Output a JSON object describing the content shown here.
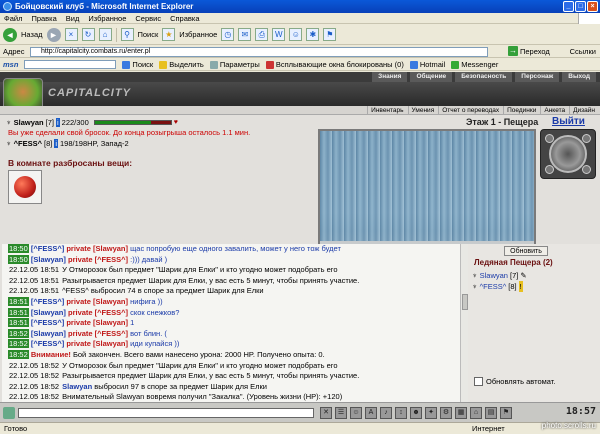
{
  "window": {
    "title": "Бойцовский клуб - Microsoft Internet Explorer",
    "min_label": "_",
    "max_label": "□",
    "close_label": "×"
  },
  "menu": [
    "Файл",
    "Правка",
    "Вид",
    "Избранное",
    "Сервис",
    "Справка"
  ],
  "toolbar": {
    "back_label": "Назад",
    "search_label": "Поиск",
    "favorites_label": "Избранное"
  },
  "address": {
    "label": "Адрес",
    "url": "http://capitalcity.combats.ru/enter.pl",
    "go_label": "Переход",
    "links_label": "Ссылки"
  },
  "msn": {
    "logo": "msn",
    "search_label": "Поиск",
    "highlight_label": "Выделить",
    "params_label": "Параметры",
    "popups_label": "Всплывающие окна блокированы (0)",
    "hotmail_label": "Hotmail",
    "messenger_label": "Messenger"
  },
  "site": {
    "topnav": [
      "Знания",
      "Общение",
      "Безопасность",
      "Персонаж",
      "Выход"
    ],
    "brand": "CAPITALCITY",
    "subnav": [
      "Инвентарь",
      "Умения",
      "Отчет о переводах",
      "Поединки",
      "Анкета",
      "Дизайн"
    ]
  },
  "player": {
    "name": "Slawyan",
    "level": "[7]",
    "hp_text": "222/300",
    "hp_fraction": 0.74,
    "notice": "Вы уже сделали свой бросок. До конца розыгрыша осталось 1.1 мин.",
    "other_name": "^FESS^",
    "other_level": "[8]",
    "other_info": "198/198HP, Запад-2"
  },
  "location": {
    "title": "Этаж 1 - Пещера",
    "exit_label": "Выйти"
  },
  "items": {
    "heading": "В комнате разбросаны вещи:"
  },
  "chat": [
    {
      "ts": "18:50",
      "ts_style": "green",
      "sender": "[^FESS^]",
      "priv": "private [Slawyan]",
      "msg": "щас попробую еще одного завалить, может у него тож будет",
      "msg_style": "blue"
    },
    {
      "ts": "18:50",
      "ts_style": "green",
      "sender": "[Slawyan]",
      "priv": "private [^FESS^]",
      "msg": ":))) давай )",
      "msg_style": "blue"
    },
    {
      "ts": "22.12.05 18:51",
      "ts_style": "plain",
      "sender": "",
      "priv": "",
      "msg": "У Отморозок был предмет \"Шарик для Елки\" и кто угодно может подобрать его",
      "msg_style": "black"
    },
    {
      "ts": "22.12.05 18:51",
      "ts_style": "plain",
      "sender": "",
      "priv": "",
      "msg": "Разыгрывается предмет Шарик для Елки, у вас есть 5 минут, чтобы принять участие.",
      "msg_style": "black"
    },
    {
      "ts": "22.12.05 18:51",
      "ts_style": "plain",
      "sender": "",
      "priv": "",
      "msg": "^FESS^ выбросил 74 в споре за предмет Шарик для Елки",
      "msg_style": "black"
    },
    {
      "ts": "18:51",
      "ts_style": "green",
      "sender": "[^FESS^]",
      "priv": "private [Slawyan]",
      "msg": "нифига ))",
      "msg_style": "blue"
    },
    {
      "ts": "18:51",
      "ts_style": "green",
      "sender": "[Slawyan]",
      "priv": "private [^FESS^]",
      "msg": "скок снежков?",
      "msg_style": "blue"
    },
    {
      "ts": "18:51",
      "ts_style": "green",
      "sender": "[^FESS^]",
      "priv": "private [Slawyan]",
      "msg": "1",
      "msg_style": "blue"
    },
    {
      "ts": "18:52",
      "ts_style": "green",
      "sender": "[Slawyan]",
      "priv": "private [^FESS^]",
      "msg": "вот блин. (",
      "msg_style": "blue"
    },
    {
      "ts": "18:52",
      "ts_style": "green",
      "sender": "[^FESS^]",
      "priv": "private [Slawyan]",
      "msg": "иди купайся ))",
      "msg_style": "blue"
    },
    {
      "ts": "18:52",
      "ts_style": "green",
      "sender": "",
      "priv": "Внимание!",
      "msg": "Бой закончен. Всего вами нанесено урона: 2000 HP. Получено опыта: 0.",
      "msg_style": "black"
    },
    {
      "ts": "22.12.05 18:52",
      "ts_style": "plain",
      "sender": "",
      "priv": "",
      "msg": "У Отморозок был предмет \"Шарик для Елки\" и кто угодно может подобрать его",
      "msg_style": "black"
    },
    {
      "ts": "22.12.05 18:52",
      "ts_style": "plain",
      "sender": "",
      "priv": "",
      "msg": "Разыгрывается предмет Шарик для Елки, у вас есть 5 минут, чтобы принять участие.",
      "msg_style": "black"
    },
    {
      "ts": "22.12.05 18:52",
      "ts_style": "plain",
      "sender": "Slawyan",
      "priv": "",
      "msg": "выбросил 97 в споре за предмет Шарик для Елки",
      "msg_style": "black"
    },
    {
      "ts": "22.12.05 18:52",
      "ts_style": "plain",
      "sender": "",
      "priv": "",
      "msg": "Внимательный Slawyan вовремя получил \"Закалка\". (Уровень жизни (HP): +120)",
      "msg_style": "black"
    }
  ],
  "room": {
    "refresh_label": "Обновить",
    "title": "Ледяная Пещера (2)",
    "members": [
      {
        "name": "Slawyan",
        "level": "[7]"
      },
      {
        "name": "^FESS^",
        "level": "[8]"
      }
    ],
    "auto_label": "Обновлять автомат."
  },
  "gamebar": {
    "time": "18:57"
  },
  "status": {
    "text": "Готово",
    "zone": "Интернет"
  },
  "watermark": "photo.scrolls.ru"
}
